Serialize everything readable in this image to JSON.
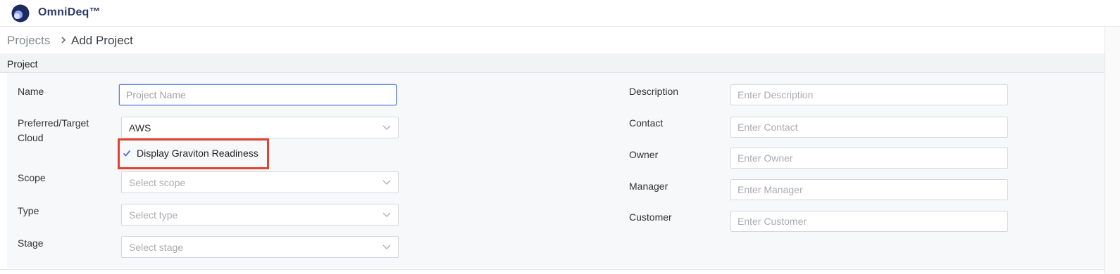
{
  "app": {
    "brand": "OmniDeq™"
  },
  "breadcrumb": {
    "root": "Projects",
    "current": "Add Project"
  },
  "section": {
    "title": "Project"
  },
  "form_left": {
    "name": {
      "label": "Name",
      "placeholder": "Project Name"
    },
    "cloud": {
      "label_line1": "Preferred/Target",
      "label_line2": "Cloud",
      "value": "AWS"
    },
    "graviton": {
      "label": "Display Graviton Readiness",
      "checked": true
    },
    "scope": {
      "label": "Scope",
      "placeholder": "Select scope"
    },
    "type": {
      "label": "Type",
      "placeholder": "Select type"
    },
    "stage": {
      "label": "Stage",
      "placeholder": "Select stage"
    }
  },
  "form_right": {
    "description": {
      "label": "Description",
      "placeholder": "Enter Description"
    },
    "contact": {
      "label": "Contact",
      "placeholder": "Enter Contact"
    },
    "owner": {
      "label": "Owner",
      "placeholder": "Enter Owner"
    },
    "manager": {
      "label": "Manager",
      "placeholder": "Enter Manager"
    },
    "customer": {
      "label": "Customer",
      "placeholder": "Enter Customer"
    }
  },
  "colors": {
    "brand": "#2d3a66",
    "focus": "#5b7fd6",
    "highlight": "#e2412f",
    "check": "#4a6fd4"
  }
}
